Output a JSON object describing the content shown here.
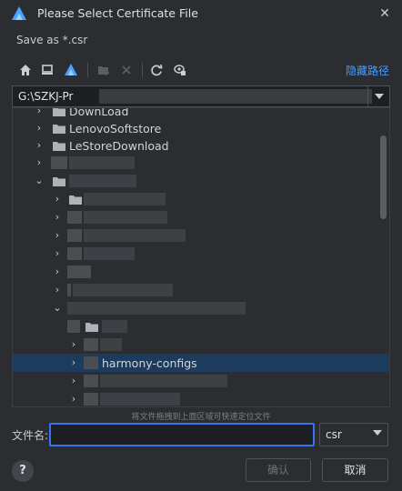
{
  "window": {
    "title": "Please Select Certificate File",
    "subtitle": "Save as *.csr",
    "close_glyph": "✕"
  },
  "toolbar": {
    "buttons": [
      {
        "icon": "home-icon"
      },
      {
        "icon": "desktop-icon"
      },
      {
        "icon": "project-icon"
      },
      {
        "icon": "new-folder-icon"
      },
      {
        "icon": "delete-icon"
      },
      {
        "icon": "refresh-icon"
      },
      {
        "icon": "show-hidden-icon"
      }
    ],
    "hide_path_label": "隐藏路径"
  },
  "path": {
    "value": "G:\\SZKJ-Pr"
  },
  "tree": {
    "rows": [
      {
        "label": "DownLoad",
        "expanded": false
      },
      {
        "label": "LenovoSoftstore",
        "expanded": false
      },
      {
        "label": "LeStoreDownload",
        "expanded": false
      },
      {
        "label": "",
        "expanded": false
      },
      {
        "label": "",
        "expanded": true
      },
      {
        "label": "harmony-configs",
        "expanded": false,
        "selected": true
      }
    ]
  },
  "hint": "将文件拖拽到上面区域可快速定位文件",
  "filename": {
    "label": "文件名:",
    "value": "",
    "extension": "csr"
  },
  "buttons": {
    "help": "?",
    "ok": "确认",
    "cancel": "取消"
  },
  "colors": {
    "accent": "#3574f0",
    "link": "#4a9bff",
    "selection": "#1d3b5c"
  }
}
